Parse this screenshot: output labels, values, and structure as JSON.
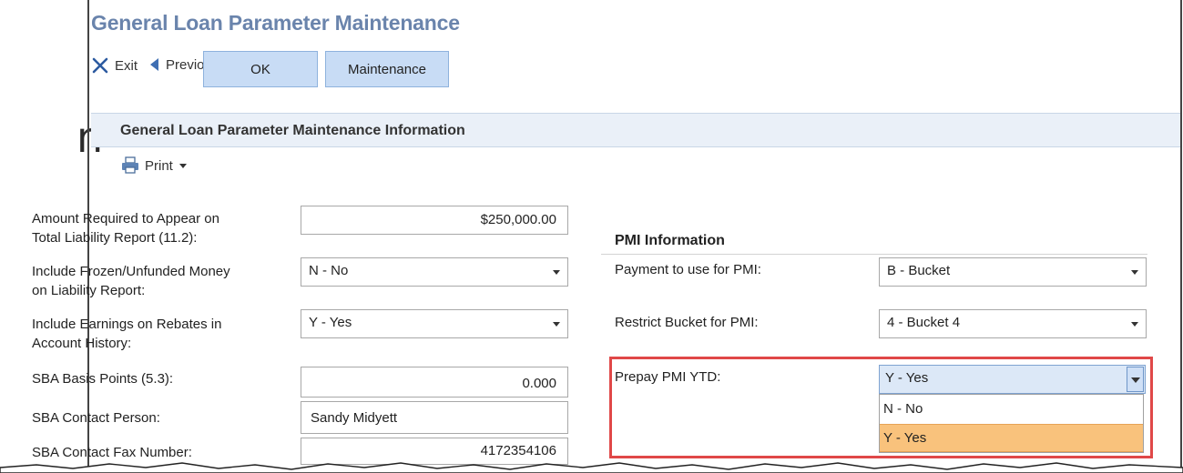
{
  "page_title": "General Loan Parameter Maintenance",
  "edge_fragment": "n",
  "toolbar": {
    "exit_label": "Exit",
    "previous_label": "Previous",
    "ok_label": "OK",
    "maintenance_label": "Maintenance"
  },
  "panel": {
    "title": "General Loan Parameter Maintenance Information",
    "print_label": "Print"
  },
  "fields": [
    {
      "label_line1": "Amount Required to Appear on",
      "label_line2": "Total Liability Report (11.2):",
      "value": "$250,000.00",
      "kind": "input"
    },
    {
      "label_line1": "Include Frozen/Unfunded Money",
      "label_line2": "on Liability Report:",
      "value": "N - No",
      "kind": "select"
    },
    {
      "label_line1": "Include Earnings on Rebates in",
      "label_line2": "Account History:",
      "value": "Y - Yes",
      "kind": "select"
    },
    {
      "label_line1": "SBA Basis Points (5.3):",
      "label_line2": "",
      "value": "0.000",
      "kind": "input"
    },
    {
      "label_line1": "SBA Contact Person:",
      "label_line2": "",
      "value": "Sandy Midyett",
      "kind": "input"
    },
    {
      "label_line1": "SBA Contact Fax Number:",
      "label_line2": "",
      "value": "4172354106",
      "kind": "input"
    }
  ],
  "pmi": {
    "header": "PMI Information",
    "payment_label": "Payment to use for PMI:",
    "payment_value": "B - Bucket",
    "restrict_label": "Restrict Bucket for PMI:",
    "restrict_value": "4 - Bucket 4",
    "prepay_label": "Prepay PMI YTD:",
    "prepay_value": "Y - Yes",
    "prepay_options": [
      "N - No",
      "Y - Yes"
    ],
    "prepay_selected_index": 1
  },
  "colors": {
    "title": "#6a84ac",
    "button_bg": "#c8dcf5",
    "highlight_border": "#e04848",
    "selected_option": "#f9c27c"
  }
}
